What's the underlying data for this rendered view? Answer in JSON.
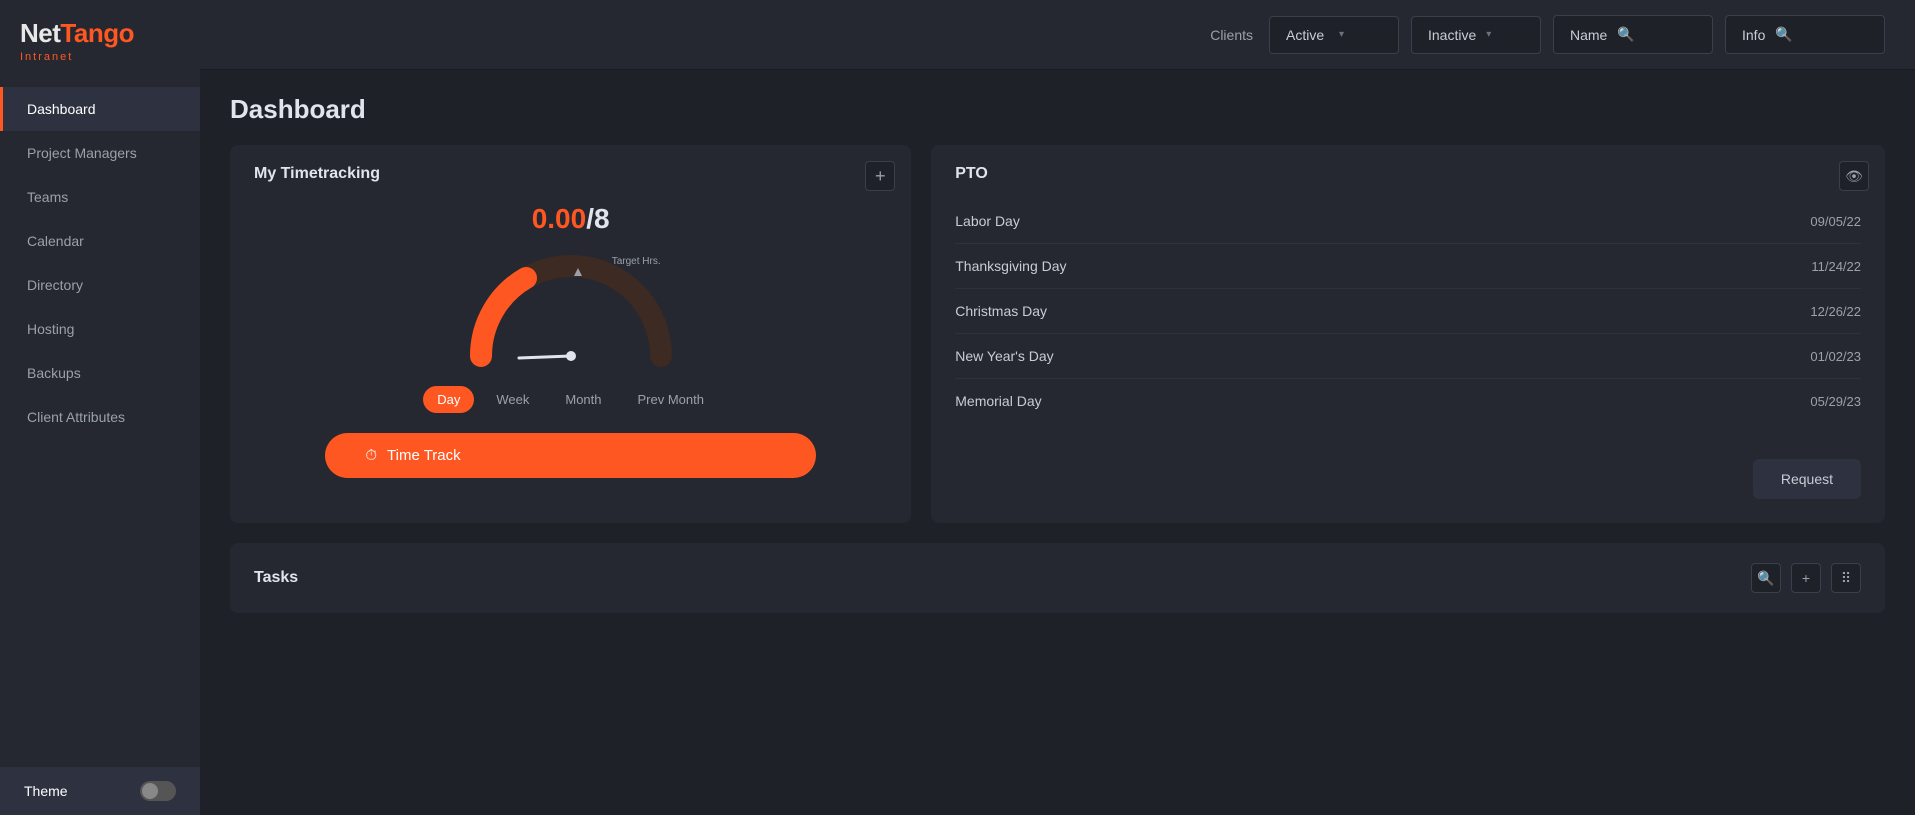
{
  "app": {
    "name_part1": "Net",
    "name_part2": "Tango",
    "sub": "Intranet"
  },
  "sidebar": {
    "items": [
      {
        "id": "dashboard",
        "label": "Dashboard",
        "active": true
      },
      {
        "id": "project-managers",
        "label": "Project Managers",
        "active": false
      },
      {
        "id": "teams",
        "label": "Teams",
        "active": false
      },
      {
        "id": "calendar",
        "label": "Calendar",
        "active": false
      },
      {
        "id": "directory",
        "label": "Directory",
        "active": false
      },
      {
        "id": "hosting",
        "label": "Hosting",
        "active": false
      },
      {
        "id": "backups",
        "label": "Backups",
        "active": false
      },
      {
        "id": "client-attributes",
        "label": "Client Attributes",
        "active": false
      }
    ],
    "theme_label": "Theme"
  },
  "header": {
    "clients_label": "Clients",
    "active_label": "Active",
    "inactive_label": "Inactive",
    "name_placeholder": "Name",
    "info_placeholder": "Info"
  },
  "page": {
    "title": "Dashboard"
  },
  "timetracking": {
    "card_title": "My Timetracking",
    "value": "0.00",
    "target": "/8",
    "gauge_label": "Target Hrs.",
    "tabs": [
      "Day",
      "Week",
      "Month",
      "Prev Month"
    ],
    "active_tab": "Day",
    "time_track_btn": "Time Track"
  },
  "pto": {
    "card_title": "PTO",
    "holidays": [
      {
        "name": "Labor Day",
        "date": "09/05/22"
      },
      {
        "name": "Thanksgiving Day",
        "date": "11/24/22"
      },
      {
        "name": "Christmas Day",
        "date": "12/26/22"
      },
      {
        "name": "New Year's Day",
        "date": "01/02/23"
      },
      {
        "name": "Memorial Day",
        "date": "05/29/23"
      }
    ],
    "request_btn": "Request"
  },
  "tasks": {
    "card_title": "Tasks"
  },
  "icons": {
    "plus": "+",
    "eye": "👁",
    "search": "🔍",
    "chevron_down": "▾",
    "clock": "⏱",
    "search_unicode": "⌕",
    "grid": "⠿"
  }
}
